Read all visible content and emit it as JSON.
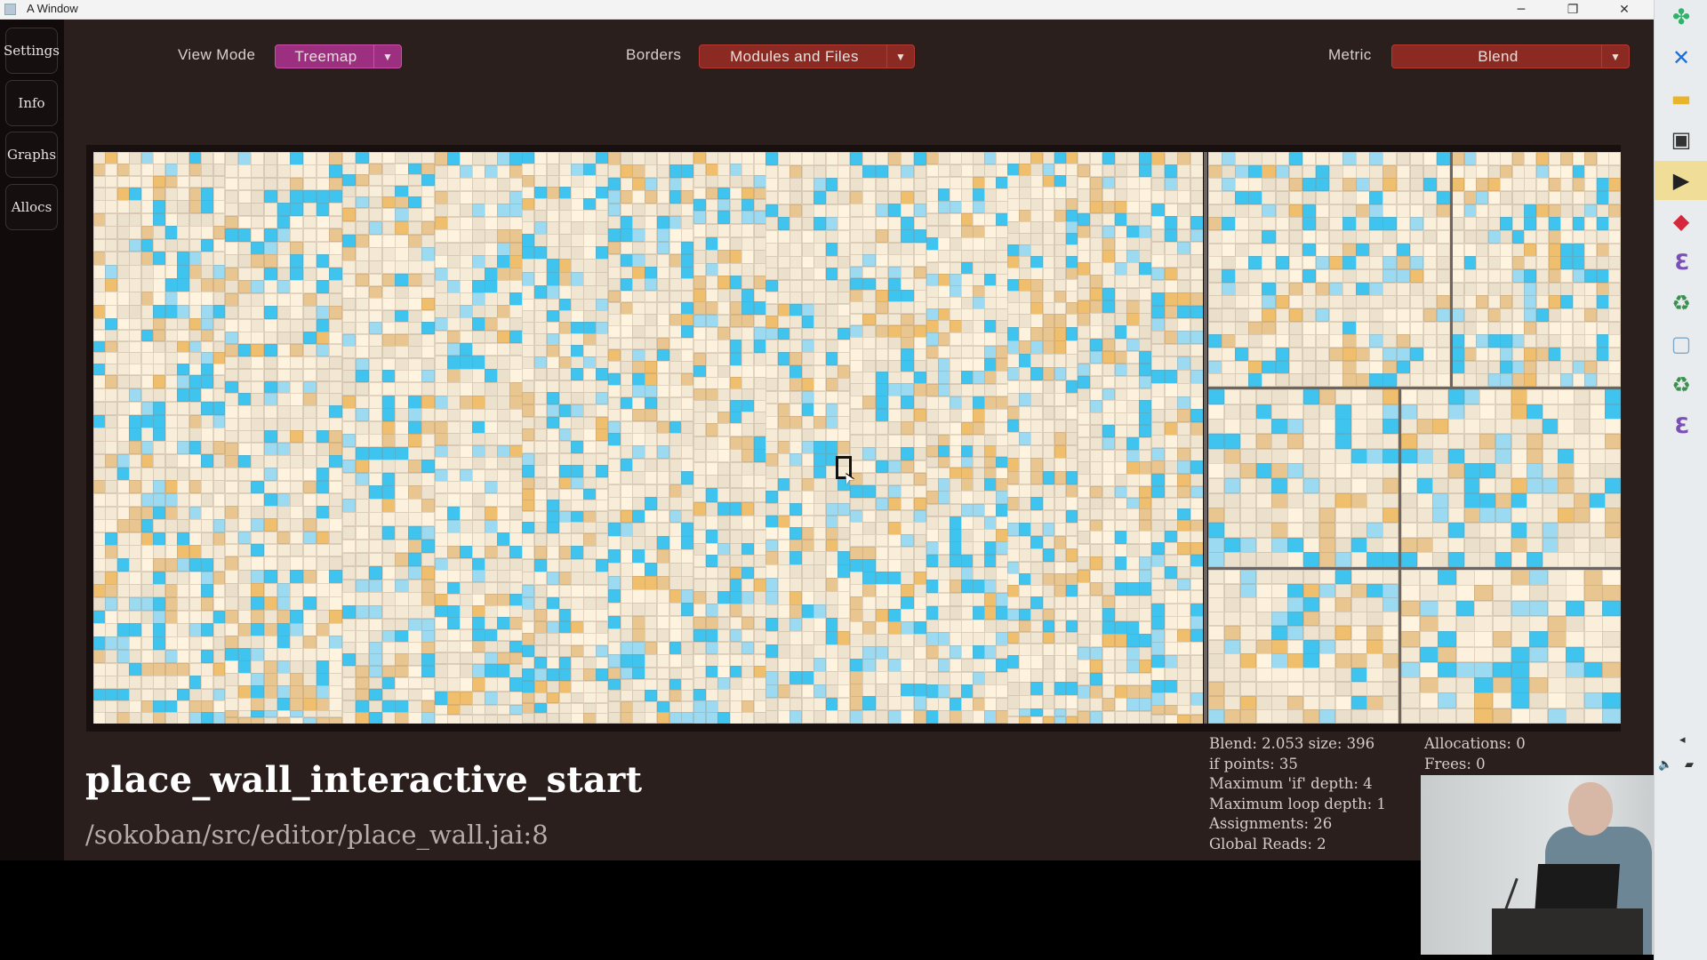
{
  "window": {
    "title": "A Window",
    "controls": [
      "─",
      "❐",
      "✕"
    ]
  },
  "sidebar": {
    "items": [
      {
        "label": "Settings"
      },
      {
        "label": "Info"
      },
      {
        "label": "Graphs"
      },
      {
        "label": "Allocs"
      }
    ]
  },
  "toolbar": {
    "view_mode": {
      "label": "View Mode",
      "value": "Treemap",
      "color": "#9c2f7f"
    },
    "borders": {
      "label": "Borders",
      "value": "Modules and Files",
      "color": "#8b2a22"
    },
    "metric": {
      "label": "Metric",
      "value": "Blend",
      "color": "#8b2a22"
    }
  },
  "treemap": {
    "colors": {
      "warm_light": "#f1e6d6",
      "warm": "#e9c690",
      "orange": "#f0bf6e",
      "blue": "#3fc3ef",
      "light_blue": "#9bdaf0",
      "border": "#6b6664"
    }
  },
  "selection": {
    "name": "place_wall_interactive_start",
    "path": "/sokoban/src/editor/place_wall.jai:8",
    "stats_left": [
      "Blend: 2.053  size: 396",
      "if points: 35",
      "Maximum 'if' depth: 4",
      "Maximum loop depth: 1",
      "Assignments: 26",
      "Global Reads: 2"
    ],
    "stats_right": [
      "Allocations: 0",
      "Frees: 0"
    ]
  },
  "taskbar": {
    "icons": [
      {
        "name": "clover-app-icon",
        "glyph": "✤",
        "color": "#2fb36a"
      },
      {
        "name": "x-app-icon",
        "glyph": "✕",
        "color": "#1b6fd6"
      },
      {
        "name": "folder-icon",
        "glyph": "▬",
        "color": "#e8b429"
      },
      {
        "name": "monitor-app-icon",
        "glyph": "▣",
        "color": "#333333"
      },
      {
        "name": "terminal-icon",
        "glyph": "▶",
        "color": "#222222"
      },
      {
        "name": "red-app-icon",
        "glyph": "◆",
        "color": "#d6283c"
      },
      {
        "name": "emacs-icon",
        "glyph": "ℇ",
        "color": "#7a4fb6"
      },
      {
        "name": "recycle-app-icon",
        "glyph": "♻",
        "color": "#3d8e4f"
      },
      {
        "name": "window-thumbnail-icon",
        "glyph": "▢",
        "color": "#7fa8c8"
      },
      {
        "name": "recycle-app-2-icon",
        "glyph": "♻",
        "color": "#3d8e4f"
      },
      {
        "name": "emacs-2-icon",
        "glyph": "ℇ",
        "color": "#7a4fb6"
      }
    ],
    "tray": [
      "◂",
      "🔈",
      "▰"
    ]
  }
}
